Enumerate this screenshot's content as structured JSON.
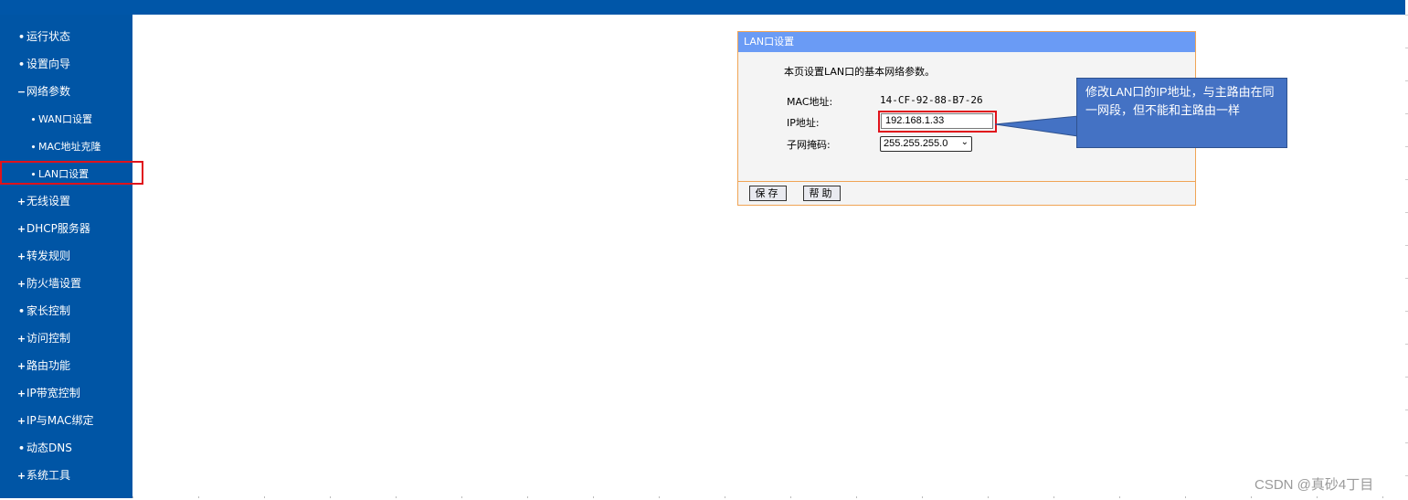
{
  "sidebar": {
    "items": [
      {
        "bullet": "•",
        "label": "运行状态"
      },
      {
        "bullet": "•",
        "label": "设置向导"
      },
      {
        "bullet": "−",
        "label": "网络参数"
      },
      {
        "bullet": "•",
        "label": "WAN口设置"
      },
      {
        "bullet": "•",
        "label": "MAC地址克隆"
      },
      {
        "bullet": "•",
        "label": "LAN口设置"
      },
      {
        "bullet": "+",
        "label": "无线设置"
      },
      {
        "bullet": "+",
        "label": "DHCP服务器"
      },
      {
        "bullet": "+",
        "label": "转发规则"
      },
      {
        "bullet": "+",
        "label": "防火墙设置"
      },
      {
        "bullet": "•",
        "label": "家长控制"
      },
      {
        "bullet": "+",
        "label": "访问控制"
      },
      {
        "bullet": "+",
        "label": "路由功能"
      },
      {
        "bullet": "+",
        "label": "IP带宽控制"
      },
      {
        "bullet": "+",
        "label": "IP与MAC绑定"
      },
      {
        "bullet": "•",
        "label": "动态DNS"
      },
      {
        "bullet": "+",
        "label": "系统工具"
      }
    ]
  },
  "panel": {
    "title": "LAN口设置",
    "intro": "本页设置LAN口的基本网络参数。",
    "mac_label": "MAC地址:",
    "mac_value": "14-CF-92-88-B7-26",
    "ip_label": "IP地址:",
    "ip_value": "192.168.1.33",
    "mask_label": "子网掩码:",
    "mask_value": "255.255.255.0",
    "save_label": "保存",
    "help_label": "帮助"
  },
  "callout": {
    "text": "修改LAN口的IP地址，与主路由在同一网段，但不能和主路由一样"
  },
  "watermark": "CSDN @真砂4丁目",
  "colors": {
    "sidebar": "#0055a5",
    "highlight": "#e0121b",
    "panel_header": "#6a9bf5",
    "callout": "#4472c4"
  }
}
